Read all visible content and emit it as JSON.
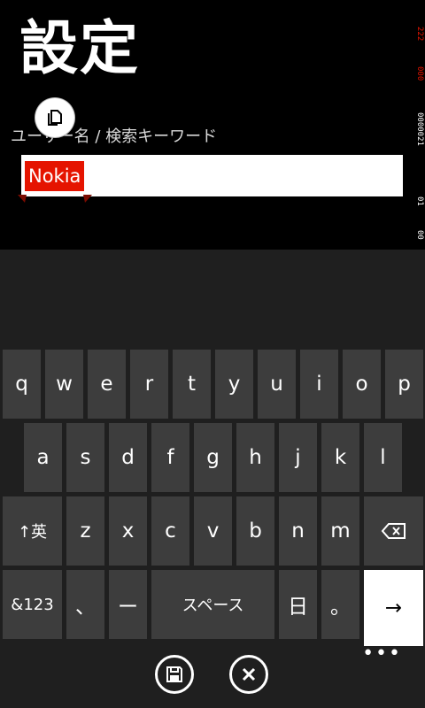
{
  "page": {
    "title": "設定",
    "field_label": "ユーザー名 / 検索キーワード"
  },
  "input": {
    "value": "Nokia",
    "selected_text": "Nokia"
  },
  "side_strip": {
    "lines": [
      "222",
      "000",
      "0000021",
      "01",
      "00"
    ]
  },
  "keyboard": {
    "row1": [
      "q",
      "w",
      "e",
      "r",
      "t",
      "y",
      "u",
      "i",
      "o",
      "p"
    ],
    "row2": [
      "a",
      "s",
      "d",
      "f",
      "g",
      "h",
      "j",
      "k",
      "l"
    ],
    "row3": {
      "shift": "↑英",
      "keys": [
        "z",
        "x",
        "c",
        "v",
        "b",
        "n",
        "m"
      ],
      "backspace": "⌫"
    },
    "row4": {
      "numbers": "&123",
      "comma": "、",
      "dash": "ー",
      "space": "スペース",
      "kanji": "日",
      "period": "。",
      "enter": "→"
    }
  },
  "appbar": {
    "more": "•••"
  },
  "colors": {
    "accent": "#e51400",
    "key": "#3d3d3d",
    "keyboard_bg": "#1f1f1f"
  }
}
